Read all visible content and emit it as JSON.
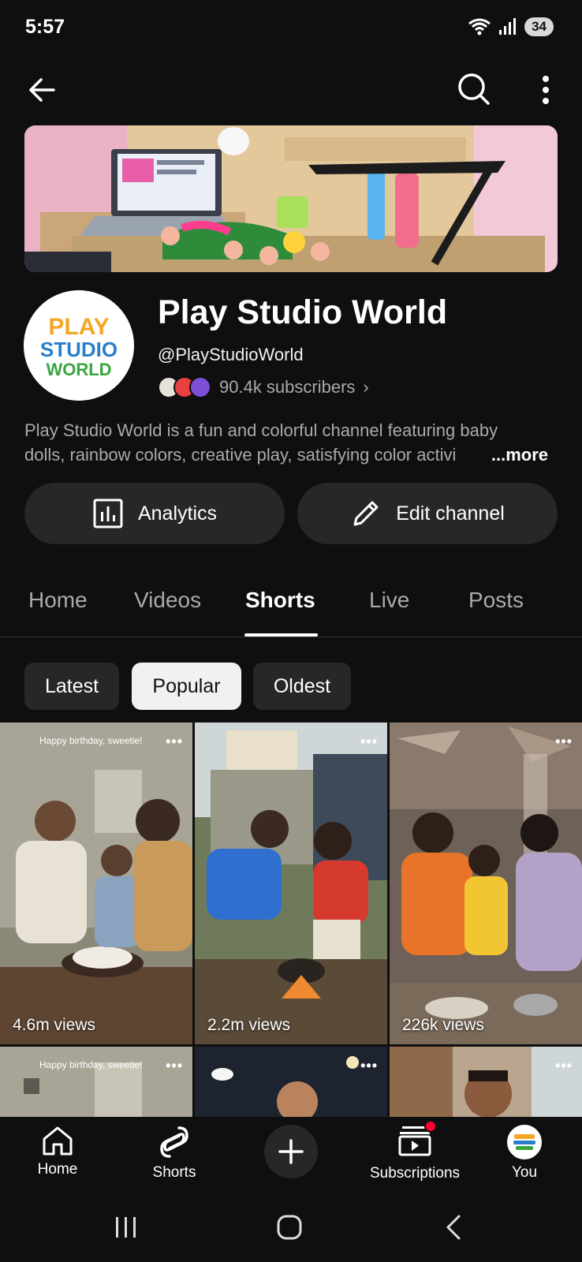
{
  "status_bar": {
    "time": "5:57",
    "battery": "34"
  },
  "channel": {
    "name": "Play Studio World",
    "handle": "@PlayStudioWorld",
    "subscribers": "90.4k subscribers",
    "description_line1": "Play Studio World is a fun and colorful channel featuring baby",
    "description_line2": "dolls, rainbow colors, creative play, satisfying color activi",
    "more_label": "...more",
    "logo_text": [
      "PLAY",
      "STUDIO",
      "WORLD"
    ]
  },
  "actions": {
    "analytics_label": "Analytics",
    "edit_label": "Edit channel"
  },
  "tabs": [
    {
      "label": "Home"
    },
    {
      "label": "Videos"
    },
    {
      "label": "Shorts",
      "active": true
    },
    {
      "label": "Live"
    },
    {
      "label": "Posts"
    }
  ],
  "chips": [
    {
      "label": "Latest"
    },
    {
      "label": "Popular",
      "active": true
    },
    {
      "label": "Oldest"
    }
  ],
  "shorts": [
    {
      "caption": "Happy birthday, sweetie!",
      "views": "4.6m views"
    },
    {
      "caption": "",
      "views": "2.2m views"
    },
    {
      "caption": "",
      "views": "226k views"
    },
    {
      "caption": "Happy birthday, sweetie!",
      "views": ""
    },
    {
      "caption": "",
      "views": ""
    },
    {
      "caption": "",
      "views": ""
    }
  ],
  "bottom_nav": {
    "home": "Home",
    "shorts": "Shorts",
    "subscriptions": "Subscriptions",
    "you": "You"
  },
  "colors": {
    "background": "#0f0f0f",
    "surface": "#272727",
    "accent": "#ff0033",
    "text_secondary": "#aaaaaa"
  }
}
